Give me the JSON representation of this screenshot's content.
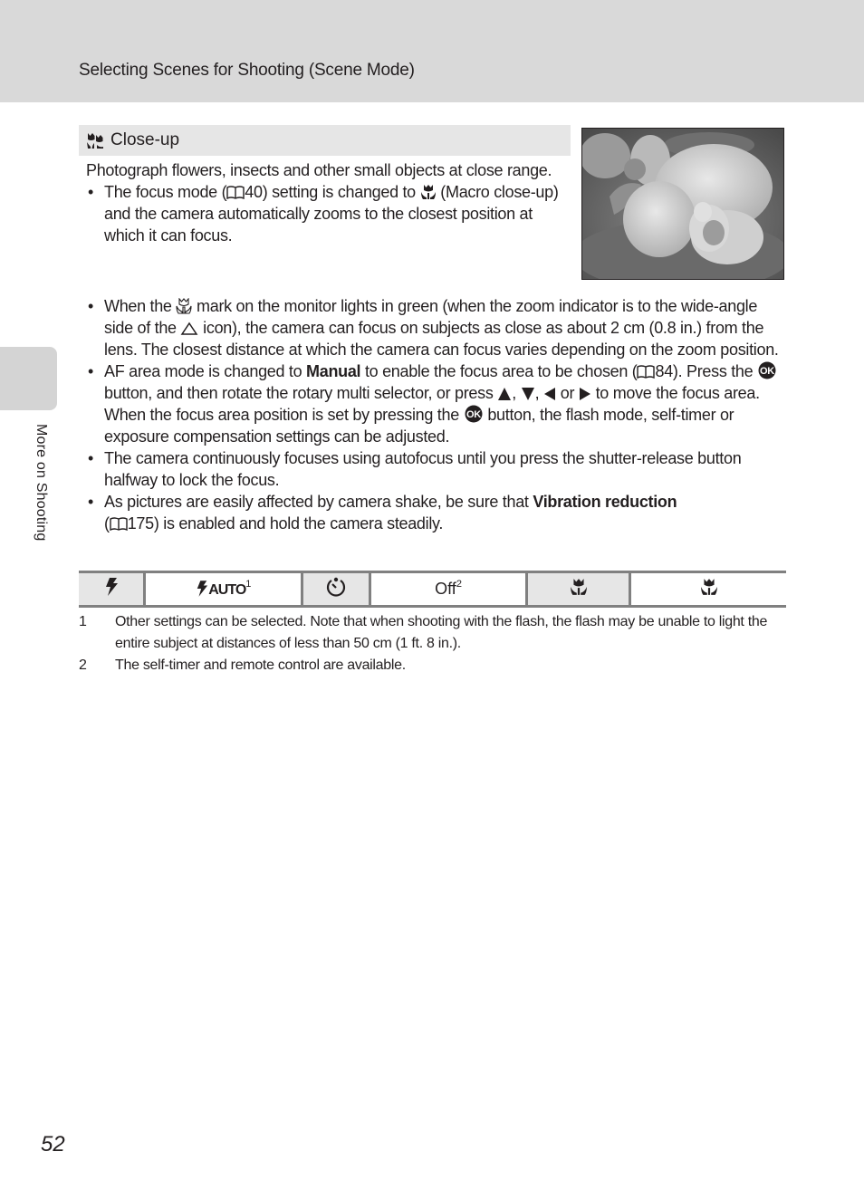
{
  "header": {
    "title": "Selecting Scenes for Shooting (Scene Mode)"
  },
  "side_tab": {
    "label": "More on Shooting"
  },
  "section": {
    "icon": "close-up-scene-icon",
    "title": "Close-up",
    "intro": "Photograph flowers, insects and other small objects at close range.",
    "intro_bullet": {
      "part1": "The focus mode (",
      "ref": "40",
      "part2": ") setting is changed to ",
      "part3": " (Macro close-up) and the camera automatically zooms to the closest position at which it can focus."
    },
    "photo": {
      "alt": "Close-up photograph of an orchid flower (grayscale)"
    }
  },
  "bullets": {
    "b1": {
      "part1": "When the ",
      "part2": " mark on the monitor lights in green (when the zoom indicator is to the wide-angle side of the ",
      "part3": " icon), the camera can focus on subjects as close as about 2 cm (0.8 in.) from the lens. The closest distance at which the camera can focus varies depending on the zoom position."
    },
    "b2": {
      "part1": "AF area mode is changed to ",
      "bold": "Manual",
      "part2": " to enable the focus area to be chosen (",
      "ref": "84",
      "part3": "). Press the ",
      "part4": " button, and then rotate the rotary multi selector, or press ",
      "sep1": ", ",
      "sep2": ", ",
      "sep3": " or ",
      "part5": " to move the focus area. When the focus area position is set by pressing the ",
      "part6": " button, the flash mode, self-timer or exposure compensation settings can be adjusted."
    },
    "b3": {
      "text": "The camera continuously focuses using autofocus until you press the shutter-release button halfway to lock the focus."
    },
    "b4": {
      "part1": "As pictures are easily affected by camera shake, be sure that ",
      "bold": "Vibration reduction",
      "part2": " (",
      "ref": "175",
      "part3": ") is enabled and hold the camera steadily."
    }
  },
  "settings_table": {
    "cells": [
      {
        "icon": "flash-mode-icon"
      },
      {
        "icon": "flash-auto-icon",
        "text": "AUTO",
        "sup": "1"
      },
      {
        "icon": "self-timer-icon"
      },
      {
        "text": "Off",
        "sup": "2"
      },
      {
        "icon": "macro-mode-icon"
      },
      {
        "icon": "macro-on-icon"
      }
    ]
  },
  "footnotes": [
    {
      "num": "1",
      "text": "Other settings can be selected. Note that when shooting with the flash, the flash may be unable to light the entire subject at distances of less than 50 cm (1 ft. 8 in.)."
    },
    {
      "num": "2",
      "text": "The self-timer and remote control are available."
    }
  ],
  "page_number": "52"
}
